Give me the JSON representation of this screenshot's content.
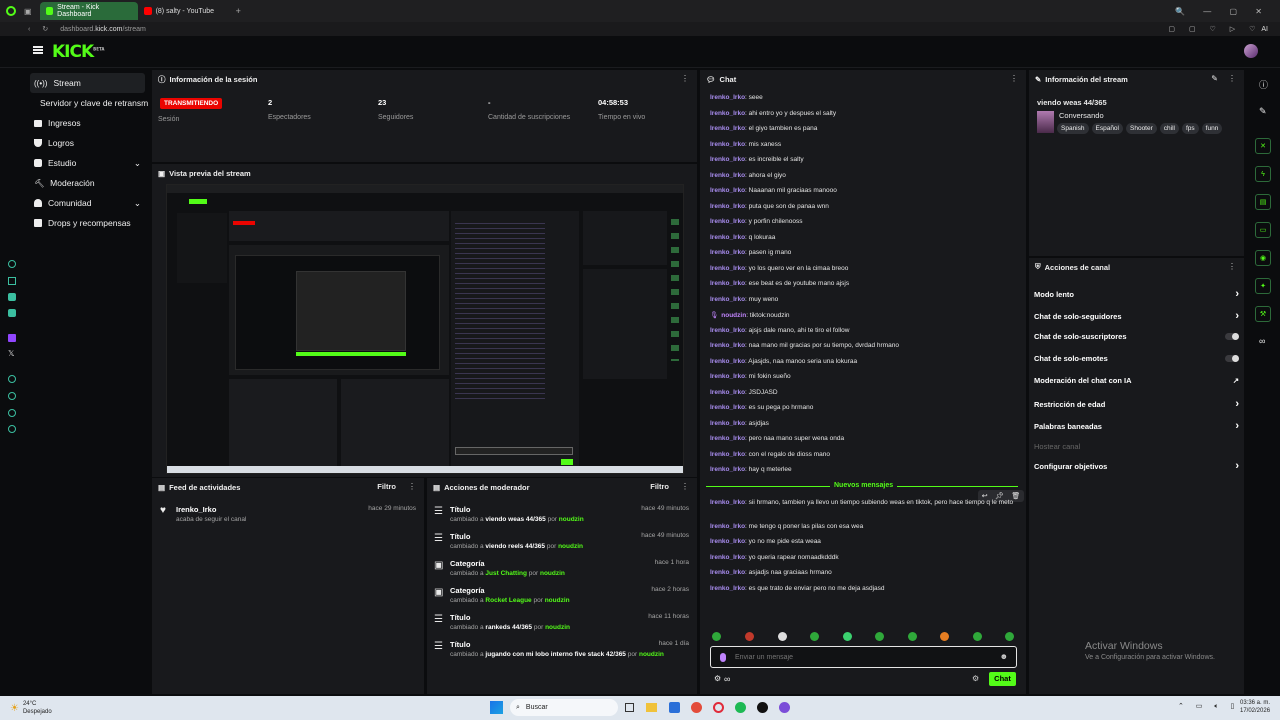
{
  "browser": {
    "tabs": [
      {
        "label": "Stream - Kick Dashboard",
        "active": true
      },
      {
        "label": "(8) salty - YouTube",
        "active": false
      }
    ],
    "url_host": "dashboard.",
    "url_domain": "kick.com",
    "url_path": "/stream",
    "ai_label": "AI"
  },
  "brand": {
    "logo": "KICK",
    "beta": "BETA"
  },
  "sidebar": {
    "items": [
      {
        "label": "Stream",
        "icon": "stream-icon"
      },
      {
        "label": "Servidor y clave de retransmisión",
        "icon": ""
      },
      {
        "label": "Ingresos",
        "icon": "wallet-icon"
      },
      {
        "label": "Logros",
        "icon": "trophy-icon"
      },
      {
        "label": "Estudio",
        "icon": "studio-icon"
      },
      {
        "label": "Moderación",
        "icon": "hammer-icon"
      },
      {
        "label": "Comunidad",
        "icon": "community-icon"
      },
      {
        "label": "Drops y recompensas",
        "icon": "gift-icon"
      }
    ]
  },
  "session": {
    "title": "Información de la sesión",
    "status_badge": "TRANSMITIENDO",
    "status_label": "Sesión",
    "stats": [
      {
        "value": "2",
        "label": "Espectadores"
      },
      {
        "value": "23",
        "label": "Seguidores"
      },
      {
        "value": "-",
        "label": "Cantidad de suscripciones"
      },
      {
        "value": "04:58:53",
        "label": "Tiempo en vivo"
      }
    ]
  },
  "preview": {
    "title": "Vista previa del stream"
  },
  "activity_feed": {
    "title": "Feed de actividades",
    "filter": "Filtro",
    "items": [
      {
        "user": "Irenko_Irko",
        "action": "acaba de seguir el canal",
        "time": "hace 29 minutos"
      }
    ]
  },
  "mod_actions": {
    "title": "Acciones de moderador",
    "filter": "Filtro",
    "items": [
      {
        "title": "Título",
        "prefix": "cambiado a",
        "value": "viendo weas 44/365",
        "by": "por",
        "user": "noudzin",
        "time": "hace 49 minutos"
      },
      {
        "title": "Título",
        "prefix": "cambiado a",
        "value": "viendo reels 44/365",
        "by": "por",
        "user": "noudzin",
        "time": "hace 49 minutos"
      },
      {
        "title": "Categoría",
        "prefix": "cambiado a",
        "value": "Just Chatting",
        "by": "por",
        "user": "noudzin",
        "time": "hace 1 hora"
      },
      {
        "title": "Categoría",
        "prefix": "cambiado a",
        "value": "Rocket League",
        "by": "por",
        "user": "noudzin",
        "time": "hace 2 horas"
      },
      {
        "title": "Título",
        "prefix": "cambiado a",
        "value": "rankeds 44/365",
        "by": "por",
        "user": "noudzin",
        "time": "hace 11 horas"
      },
      {
        "title": "Título",
        "prefix": "cambiado a",
        "value": "jugando con mi lobo interno five stack 42/365",
        "by": "por",
        "user": "noudzin",
        "time": "hace 1 día"
      }
    ]
  },
  "chat": {
    "title": "Chat",
    "messages": [
      {
        "user": "Irenko_Irko",
        "text": ": seee"
      },
      {
        "user": "Irenko_Irko",
        "text": ": ahi entro yo y despues el salty"
      },
      {
        "user": "Irenko_Irko",
        "text": ": el giyo tambien es pana"
      },
      {
        "user": "Irenko_Irko",
        "text": ": mis xaness"
      },
      {
        "user": "Irenko_Irko",
        "text": ": es increible el salty"
      },
      {
        "user": "Irenko_Irko",
        "text": ": ahora el giyo"
      },
      {
        "user": "Irenko_Irko",
        "text": ": Naaanan mil graciaas manooo"
      },
      {
        "user": "Irenko_Irko",
        "text": ": puta que son de panaa wnn"
      },
      {
        "user": "Irenko_Irko",
        "text": ": y porfin chilenooss"
      },
      {
        "user": "Irenko_Irko",
        "text": ": q lokuraa"
      },
      {
        "user": "Irenko_Irko",
        "text": ": pasen ig mano"
      },
      {
        "user": "Irenko_Irko",
        "text": ": yo los quero ver en la cimaa breoo"
      },
      {
        "user": "Irenko_Irko",
        "text": ": ese beat es de youtube mano ajsjs"
      },
      {
        "user": "Irenko_Irko",
        "text": ": muy weno"
      },
      {
        "user": "noudzin",
        "text": ": tiktok:noudzin"
      },
      {
        "user": "Irenko_Irko",
        "text": ": ajsjs dale mano, ahi te tiro el follow"
      },
      {
        "user": "Irenko_Irko",
        "text": ": naa mano mil gracias por su tiempo, dvrdad hrmano"
      },
      {
        "user": "Irenko_Irko",
        "text": ": Ajasjds, naa manoo seria una lokuraa"
      },
      {
        "user": "Irenko_Irko",
        "text": ": mi fokin sueño"
      },
      {
        "user": "Irenko_Irko",
        "text": ": JSDJASD"
      },
      {
        "user": "Irenko_Irko",
        "text": ": es su pega po hrmano"
      },
      {
        "user": "Irenko_Irko",
        "text": ": asjdjas"
      },
      {
        "user": "Irenko_Irko",
        "text": ": pero naa mano super wena onda"
      },
      {
        "user": "Irenko_Irko",
        "text": ": con el regalo de dioss mano"
      },
      {
        "user": "Irenko_Irko",
        "text": ": hay q meterlee"
      }
    ],
    "new_messages_label": "Nuevos mensajes",
    "new_messages": [
      {
        "user": "Irenko_Irko",
        "text": ": sii hrmano, tambien ya llevo un tiempo subiendo weas en tiktok, pero hace tiempo q le meto"
      },
      {
        "user": "Irenko_Irko",
        "text": ": me tengo q poner las pilas con esa wea"
      },
      {
        "user": "Irenko_Irko",
        "text": ": yo no me pide esta weaa"
      },
      {
        "user": "Irenko_Irko",
        "text": ": yo queria rapear nomaadkdddk"
      },
      {
        "user": "Irenko_Irko",
        "text": ": asjadjs naa graciaas hrmano"
      },
      {
        "user": "Irenko_Irko",
        "text": ": es que trato de enviar pero no me deja asdjasd"
      }
    ],
    "input_placeholder": "Enviar un mensaje",
    "send_button": "Chat",
    "infinity": "∞"
  },
  "stream_info": {
    "title": "Información del stream",
    "stream_title": "viendo weas 44/365",
    "category": "Conversando",
    "tags": [
      "Spanish",
      "Español",
      "Shooter",
      "chill",
      "fps",
      "funn"
    ]
  },
  "channel_actions": {
    "title": "Acciones de canal",
    "items": [
      {
        "label": "Modo lento",
        "control": "arrow"
      },
      {
        "label": "Chat de solo-seguidores",
        "control": "arrow"
      },
      {
        "label": "Chat de solo-suscriptores",
        "control": "toggle"
      },
      {
        "label": "Chat de solo-emotes",
        "control": "toggle"
      },
      {
        "label": "Moderación del chat con IA",
        "control": "external"
      },
      {
        "label": "Restricción de edad",
        "control": "arrow"
      },
      {
        "label": "Palabras baneadas",
        "control": "arrow"
      },
      {
        "label": "Hostear canal",
        "control": "none"
      },
      {
        "label": "Configurar objetivos",
        "control": "arrow"
      }
    ]
  },
  "watermark": {
    "line1": "Activar Windows",
    "line2": "Ve a Configuración para activar Windows."
  },
  "taskbar": {
    "weather_temp": "24°C",
    "weather_desc": "Despejado",
    "search": "Buscar",
    "time": "03:36 a. m.",
    "date": "17/02/2026"
  },
  "colors": {
    "accent": "#53fc18",
    "live_badge": "#eb0400",
    "panel": "#18191c",
    "bg": "#0b0c0e"
  }
}
